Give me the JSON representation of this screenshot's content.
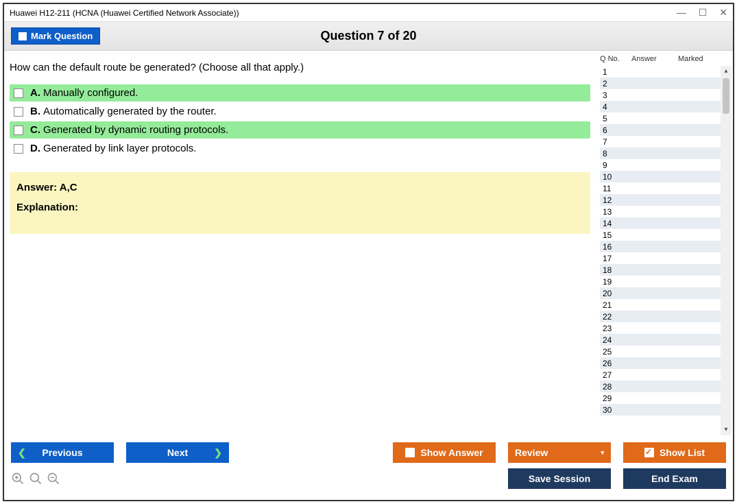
{
  "window_title": "Huawei H12-211 (HCNA (Huawei Certified Network Associate))",
  "mark_btn": "Mark Question",
  "counter": "Question 7 of 20",
  "question": "How can the default route be generated? (Choose all that apply.)",
  "options": [
    {
      "letter": "A.",
      "text": "Manually configured.",
      "correct": true
    },
    {
      "letter": "B.",
      "text": "Automatically generated by the router.",
      "correct": false
    },
    {
      "letter": "C.",
      "text": "Generated by dynamic routing protocols.",
      "correct": true
    },
    {
      "letter": "D.",
      "text": "Generated by link layer protocols.",
      "correct": false
    }
  ],
  "answer_label": "Answer: ",
  "answer_value": "A,C",
  "explanation_label": "Explanation:",
  "side": {
    "qno": "Q No.",
    "answer": "Answer",
    "marked": "Marked"
  },
  "rows": [
    1,
    2,
    3,
    4,
    5,
    6,
    7,
    8,
    9,
    10,
    11,
    12,
    13,
    14,
    15,
    16,
    17,
    18,
    19,
    20,
    21,
    22,
    23,
    24,
    25,
    26,
    27,
    28,
    29,
    30
  ],
  "buttons": {
    "previous": "Previous",
    "next": "Next",
    "show_answer": "Show Answer",
    "review": "Review",
    "show_list": "Show List",
    "save_session": "Save Session",
    "end_exam": "End Exam"
  }
}
